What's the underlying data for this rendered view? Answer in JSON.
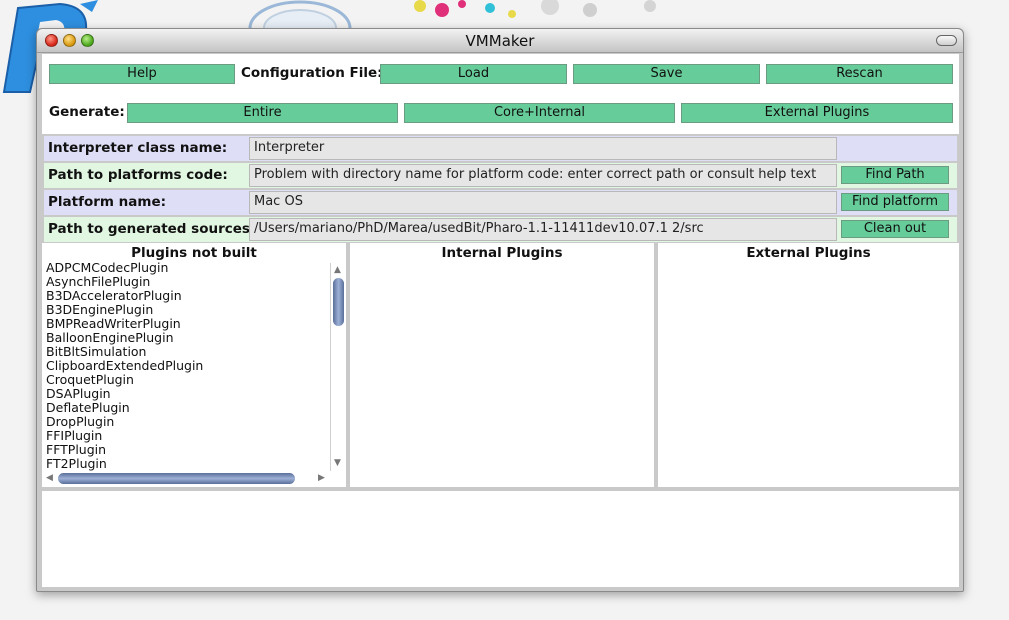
{
  "window": {
    "title": "VMMaker"
  },
  "toolbar": {
    "help_label": "Help",
    "config_label": "Configuration File:",
    "load_label": "Load",
    "save_label": "Save",
    "rescan_label": "Rescan",
    "generate_label": "Generate:",
    "entire_label": "Entire",
    "core_internal_label": "Core+Internal",
    "external_plugins_label": "External Plugins"
  },
  "fields": {
    "interpreter": {
      "label": "Interpreter class name:",
      "value": "Interpreter"
    },
    "platforms_path": {
      "label": "Path to platforms code:",
      "value": "Problem with directory name for platform code: enter correct path or consult help text",
      "button": "Find Path"
    },
    "platform_name": {
      "label": "Platform name:",
      "value": "Mac OS",
      "button": "Find platform"
    },
    "generated_path": {
      "label": "Path to generated sources:",
      "value": "/Users/mariano/PhD/Marea/usedBit/Pharo-1.1-11411dev10.07.1 2/src",
      "button": "Clean out"
    }
  },
  "lists": {
    "not_built": {
      "title": "Plugins not built",
      "items": [
        "ADPCMCodecPlugin",
        "AsynchFilePlugin",
        "B3DAcceleratorPlugin",
        "B3DEnginePlugin",
        "BMPReadWriterPlugin",
        "BalloonEnginePlugin",
        "BitBltSimulation",
        "ClipboardExtendedPlugin",
        "CroquetPlugin",
        "DSAPlugin",
        "DeflatePlugin",
        "DropPlugin",
        "FFIPlugin",
        "FFTPlugin",
        "FT2Plugin"
      ]
    },
    "internal": {
      "title": "Internal Plugins"
    },
    "external": {
      "title": "External Plugins"
    }
  },
  "colors": {
    "button": "#66cc99",
    "field_tint_lavender": "#dedef6",
    "field_tint_green": "#e2f7e2"
  },
  "icons": [
    "close-icon",
    "minimize-icon",
    "zoom-icon",
    "toolbar-toggle-icon"
  ]
}
